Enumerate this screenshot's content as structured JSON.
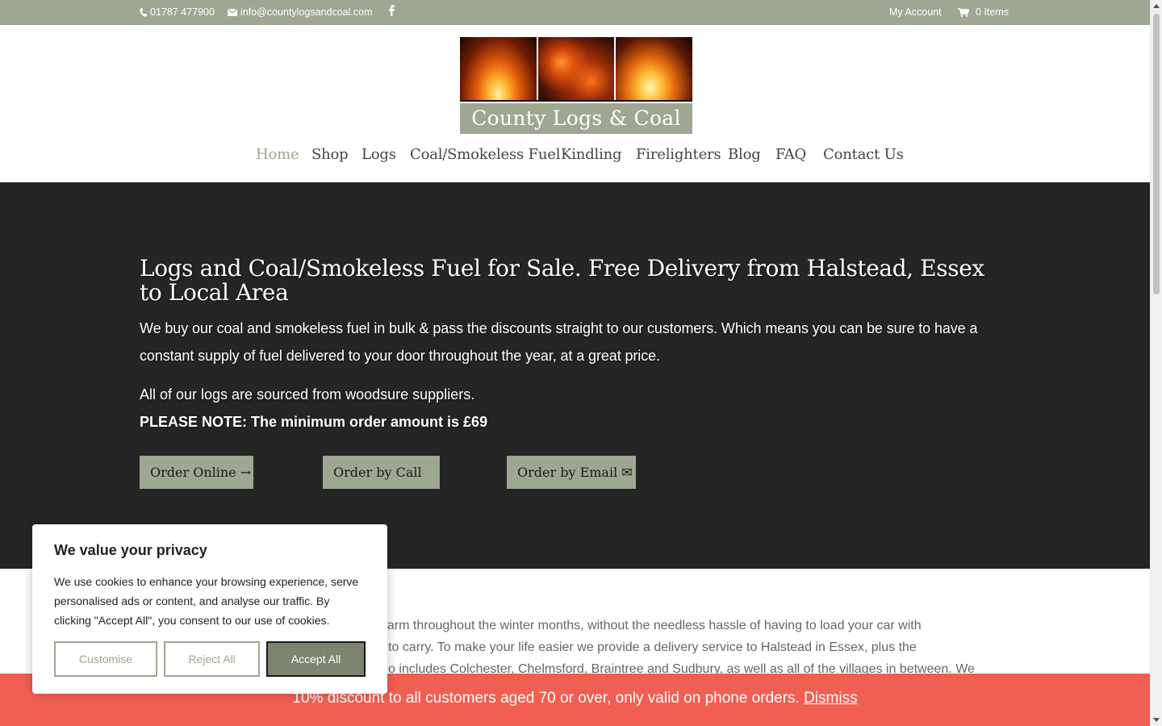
{
  "topbar": {
    "phone": "01787 477900",
    "email": "info@countylogsandcoal.com",
    "account": "My Account",
    "cart": "0 Items",
    "bg_color": "#9ea791"
  },
  "logo": {
    "text": "County Logs & Coal"
  },
  "nav": {
    "items": [
      "Home",
      "Shop",
      "Logs",
      "Coal/Smokeless Fuel",
      "Kindling",
      "Firelighters",
      "Blog",
      "FAQ",
      "Contact Us"
    ],
    "active": "Home"
  },
  "hero": {
    "title": "Logs and Coal/Smokeless Fuel for Sale. Free Delivery from Halstead, Essex to Local Area",
    "intro": "We buy our coal and smokeless fuel in bulk & pass the discounts straight to our customers. Which means you can be sure to have a constant supply of fuel delivered to your door throughout the year, at a great price.",
    "sourced": "All of our logs are sourced from woodsure suppliers.",
    "note": "PLEASE NOTE: The minimum order amount is £69",
    "btn_online": "Order Online →",
    "btn_call": "Order by Call",
    "btn_email": "Order by Email ✉"
  },
  "body": {
    "line1": "g warm throughout the winter months, without the needless hassle of having to load your car with",
    "line2": "to carry. To make your life easier we provide a delivery service to Halstead in Essex, plus the",
    "line3": "o includes Colchester, Chelmsford, Braintree and Sudbury, as well as all of the villages in between. We"
  },
  "cookie": {
    "title": "We value your privacy",
    "text": "We use cookies to enhance your browsing experience, serve personalised ads or content, and analyse our traffic. By clicking \"Accept All\", you consent to our use of cookies.",
    "customise": "Customise",
    "reject": "Reject All",
    "accept": "Accept All"
  },
  "discount": {
    "text": "10% discount to all customers aged 70 or over, only valid on phone orders.",
    "dismiss": "Dismiss",
    "bg_color": "#f05f52"
  },
  "icons": [
    "phone-icon",
    "envelope-icon",
    "facebook-icon",
    "cart-icon"
  ]
}
